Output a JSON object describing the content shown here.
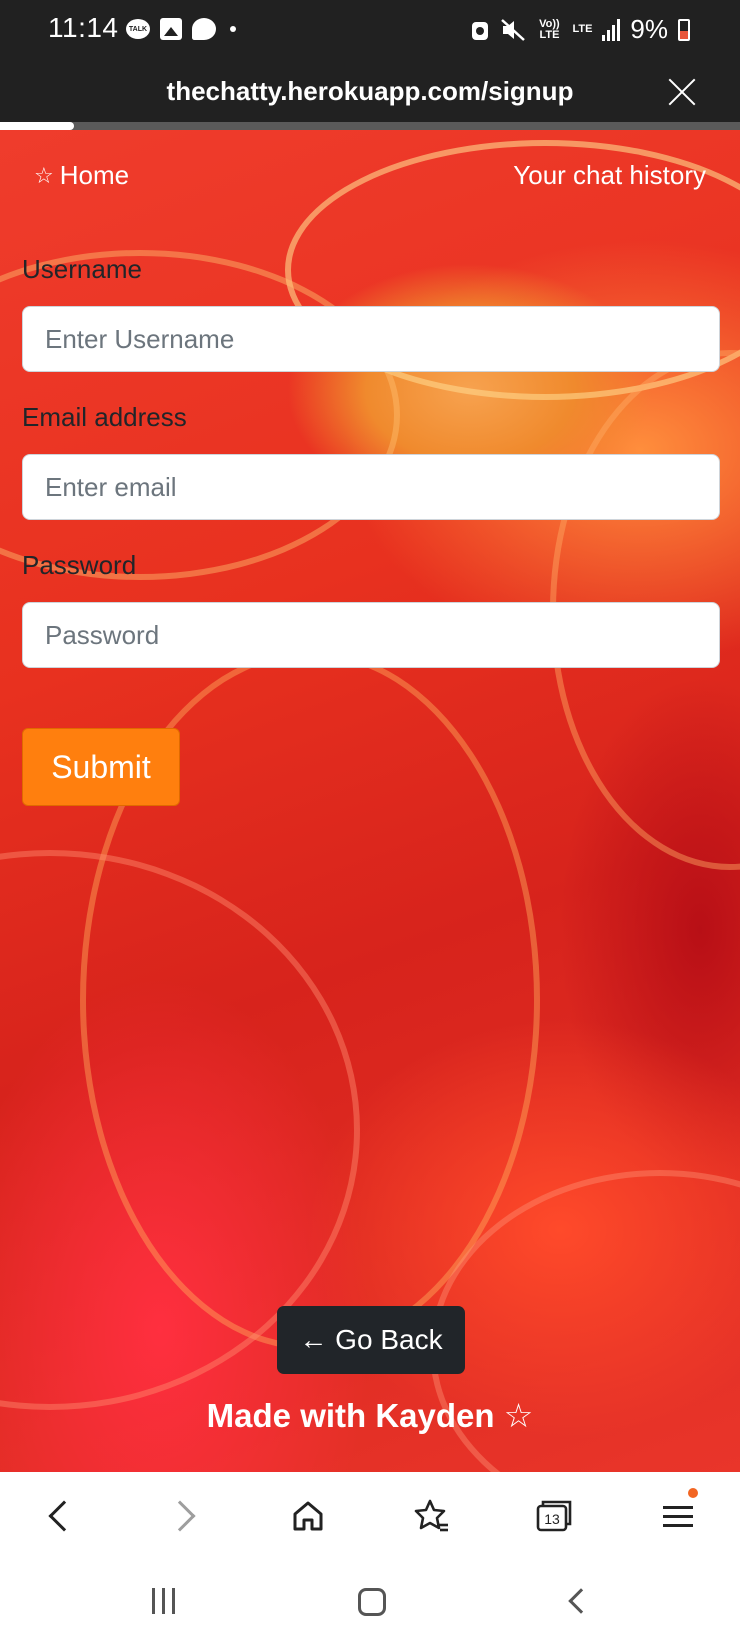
{
  "status_bar": {
    "time": "11:14",
    "talk_label": "TALK",
    "volte_label": "Vo)) LTE",
    "lte_label": "LTE",
    "battery_percent": "9%",
    "battery_color": "#e8563b"
  },
  "browser": {
    "url": "thechatty.herokuapp.com/signup",
    "load_progress": 0.1
  },
  "nav": {
    "home_icon": "☆",
    "home_label": "Home",
    "history_label": "Your chat history"
  },
  "form": {
    "username_label": "Username",
    "username_placeholder": "Enter Username",
    "email_label": "Email address",
    "email_placeholder": "Enter email",
    "password_label": "Password",
    "password_placeholder": "Password",
    "submit_label": "Submit",
    "submit_color": "#ff7f0e"
  },
  "footer": {
    "go_back_label": "← Go Back",
    "made_with_label": "Made with Kayden ☆"
  },
  "bottom_bar": {
    "tabs_count": "13",
    "icons": [
      "back-icon",
      "forward-icon",
      "home-icon",
      "bookmarks-icon",
      "tabs-icon",
      "menu-icon"
    ]
  },
  "system_nav": {
    "icons": [
      "recents-icon",
      "home-icon",
      "back-icon"
    ]
  }
}
